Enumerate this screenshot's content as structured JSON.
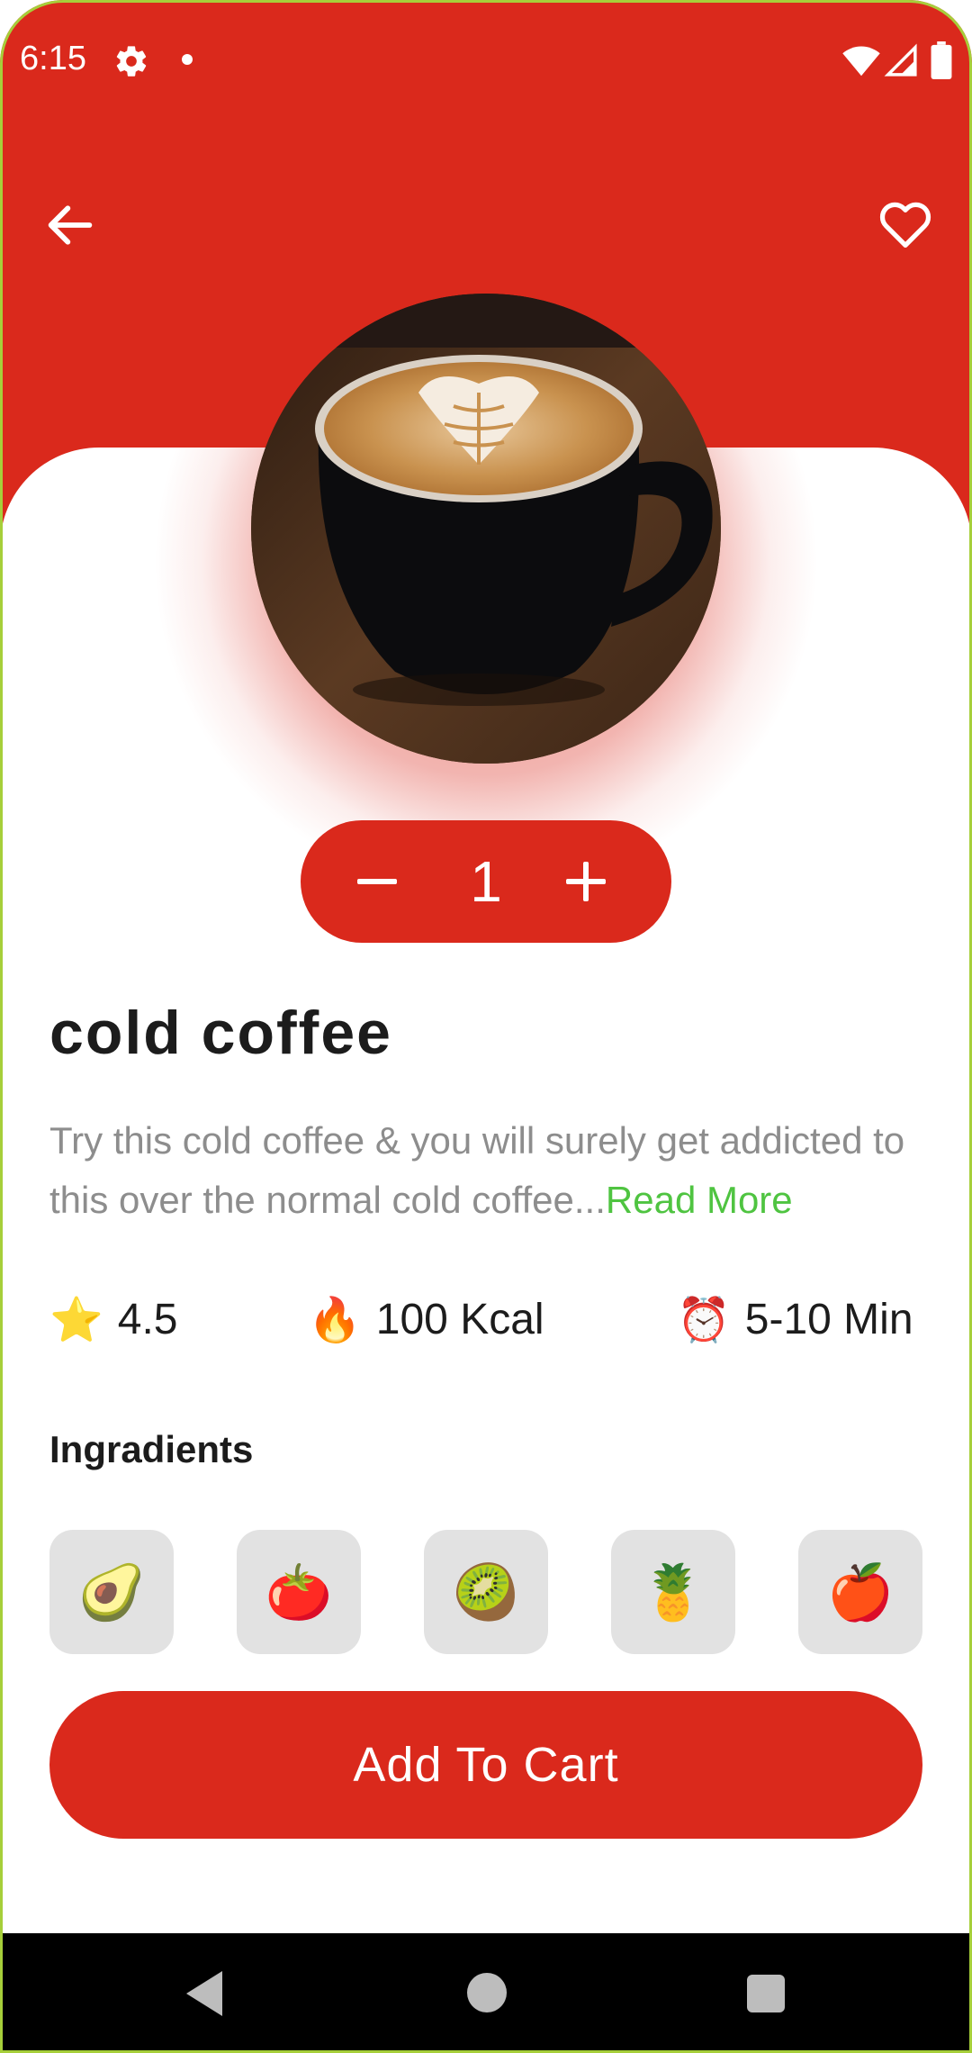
{
  "status_bar": {
    "time": "6:15"
  },
  "product": {
    "title": "cold coffee",
    "description": "Try this cold coffee & you will surely get addicted to this over the normal cold coffee...",
    "read_more": "Read More",
    "quantity": "1"
  },
  "stats": [
    {
      "icon": "star-icon",
      "emoji": "⭐",
      "value": "4.5"
    },
    {
      "icon": "fire-icon",
      "emoji": "🔥",
      "value": "100 Kcal"
    },
    {
      "icon": "alarm-clock-icon",
      "emoji": "⏰",
      "value": "5-10 Min"
    }
  ],
  "ingredients": {
    "title": "Ingradients",
    "items": [
      {
        "icon": "avocado-icon",
        "emoji": "🥑"
      },
      {
        "icon": "tomato-icon",
        "emoji": "🍅"
      },
      {
        "icon": "kiwi-icon",
        "emoji": "🥝"
      },
      {
        "icon": "pineapple-icon",
        "emoji": "🍍"
      },
      {
        "icon": "apple-icon",
        "emoji": "🍎"
      }
    ]
  },
  "actions": {
    "add_to_cart": "Add To Cart"
  },
  "colors": {
    "primary": "#da291c",
    "accent_green": "#4fc441",
    "chip_bg": "#e2e2e2"
  }
}
